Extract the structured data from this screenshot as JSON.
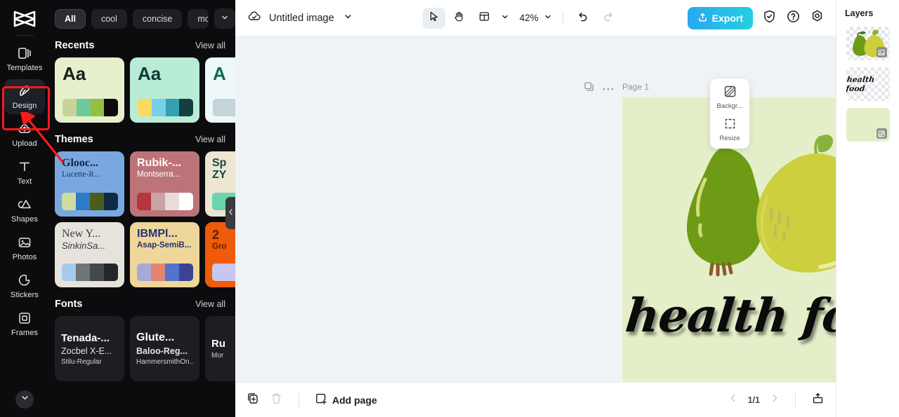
{
  "rail": {
    "logo_icon": "capcut-logo-icon",
    "items": [
      {
        "label": "Templates",
        "icon": "templates-icon",
        "active": false
      },
      {
        "label": "Design",
        "icon": "design-icon",
        "active": true
      },
      {
        "label": "Upload",
        "icon": "upload-cloud-icon",
        "active": false
      },
      {
        "label": "Text",
        "icon": "text-icon",
        "active": false
      },
      {
        "label": "Shapes",
        "icon": "shapes-icon",
        "active": false
      },
      {
        "label": "Photos",
        "icon": "photos-icon",
        "active": false
      },
      {
        "label": "Stickers",
        "icon": "stickers-icon",
        "active": false
      },
      {
        "label": "Frames",
        "icon": "frames-icon",
        "active": false
      }
    ],
    "more_icon": "chevron-down-icon"
  },
  "panel": {
    "filters": [
      {
        "label": "All",
        "active": true
      },
      {
        "label": "cool",
        "active": false
      },
      {
        "label": "concise",
        "active": false
      },
      {
        "label": "modern",
        "active": false
      }
    ],
    "filter_more_icon": "chevron-down-icon",
    "view_all": "View all",
    "recents": {
      "title": "Recents",
      "cards": [
        {
          "sample": "Aa",
          "bg": "#e7f0cd",
          "text_color": "#1c1c1c",
          "swatches": [
            "#c6d49a",
            "#6fc99a",
            "#95bf3f",
            "#0b0b0b"
          ]
        },
        {
          "sample": "Aa",
          "bg": "#b9ecd6",
          "text_color": "#0e3b33",
          "swatches": [
            "#fbd95e",
            "#79cfe8",
            "#33a0b4",
            "#133f3c"
          ]
        },
        {
          "sample": "A",
          "bg": "#eef7fa",
          "text_color": "#0c6b52",
          "swatches": [
            "#c5d4d8",
            "#c5d4d8",
            "#c5d4d8",
            "#c5d4d8"
          ]
        }
      ]
    },
    "themes": {
      "title": "Themes",
      "cards": [
        {
          "line1": "Glooc...",
          "line2": "Lucette-R...",
          "bg": "#79a8e0",
          "c1": "#12263f",
          "c2": "#1b3350",
          "swatches": [
            "#cfdc9f",
            "#2d7ac9",
            "#4b5c1c",
            "#0e2a42"
          ]
        },
        {
          "line1": "Rubik-...",
          "line2": "Montserra...",
          "bg": "#bd7478",
          "c1": "#ffffff",
          "c2": "#ffffff",
          "swatches": [
            "#b7353c",
            "#c9a3a5",
            "#e8dcdb",
            "#ffffff"
          ]
        },
        {
          "line1": "Sp",
          "line2": "ZY",
          "bg": "#ece6d2",
          "c1": "#134b3f",
          "c2": "#134b3f",
          "swatches": [
            "#6bd4ad",
            "#6bd4ad",
            "#6bd4ad",
            "#6bd4ad"
          ]
        },
        {
          "line1": "New Y...",
          "line2": "SinkinSa...",
          "bg": "#e6e3dd",
          "c1": "#3b3b3b",
          "c2": "#3b3b3b",
          "swatches": [
            "#a4cbec",
            "#6e757b",
            "#43484d",
            "#23262a"
          ]
        },
        {
          "line1": "IBMPl...",
          "line2": "Asap-SemiB...",
          "bg": "#efd79b",
          "c1": "#26307a",
          "c2": "#26307a",
          "swatches": [
            "#a9a9d8",
            "#e38371",
            "#5274cc",
            "#3e4391"
          ]
        },
        {
          "line1": "2",
          "line2": "Gro",
          "bg": "#ef5b08",
          "c1": "#5c2207",
          "c2": "#5c2207",
          "swatches": [
            "#c6c6ef",
            "#c6c6ef",
            "#c6c6ef",
            "#c6c6ef"
          ]
        }
      ]
    },
    "fonts": {
      "title": "Fonts",
      "cards": [
        {
          "line1": "Tenada-...",
          "line2": "Zocbel X-E...",
          "line3": "Stilu-Regular"
        },
        {
          "line1": "Glute...",
          "line2": "Baloo-Reg...",
          "line3": "HammersmithOn..."
        },
        {
          "line1": "Ru",
          "line2": "",
          "line3": "Mor"
        }
      ]
    },
    "next_icon": "chevron-right-icon",
    "collapse_icon": "chevron-left-icon"
  },
  "topbar": {
    "cloud_icon": "cloud-saved-icon",
    "title": "Untitled image",
    "title_chevron_icon": "chevron-down-icon",
    "tools": [
      {
        "name": "select-tool",
        "icon": "cursor-arrow-icon",
        "selected": true
      },
      {
        "name": "hand-tool",
        "icon": "hand-icon",
        "selected": false
      },
      {
        "name": "layout-tool",
        "icon": "layout-grid-icon",
        "selected": false
      }
    ],
    "layout_chevron_icon": "chevron-down-icon",
    "zoom": "42%",
    "zoom_chevron_icon": "chevron-down-icon",
    "undo_icon": "undo-icon",
    "redo_icon": "redo-icon",
    "export_label": "Export",
    "export_icon": "export-upload-icon",
    "export_color": "#2aa7f0",
    "shield_icon": "shield-check-icon",
    "help_icon": "question-circle-icon",
    "settings_icon": "gear-icon"
  },
  "canvas": {
    "page_label": "Page 1",
    "duplicate_page_icon": "duplicate-icon",
    "more_icon": "more-horizontal-icon",
    "artboard_bg": "#e4efca",
    "artwork_text": "health food",
    "float_tools": [
      {
        "label": "Backgr...",
        "icon": "background-icon"
      },
      {
        "label": "Resize",
        "icon": "resize-icon"
      }
    ]
  },
  "bottombar": {
    "duplicate_icon": "duplicate-page-icon",
    "delete_icon": "trash-icon",
    "add_page_icon": "add-page-icon",
    "add_page_label": "Add page",
    "prev_icon": "chevron-left-icon",
    "page_indicator": "1/1",
    "next_icon": "chevron-right-icon",
    "present_icon": "present-icon"
  },
  "layers": {
    "title": "Layers",
    "items": [
      {
        "name": "pears-image-layer",
        "type": "image",
        "badge_icon": "image-icon",
        "label": ""
      },
      {
        "name": "health-food-text-layer",
        "type": "text",
        "badge_icon": "",
        "label": "health food"
      },
      {
        "name": "background-layer",
        "type": "background",
        "badge_icon": "background-icon",
        "label": ""
      }
    ]
  }
}
